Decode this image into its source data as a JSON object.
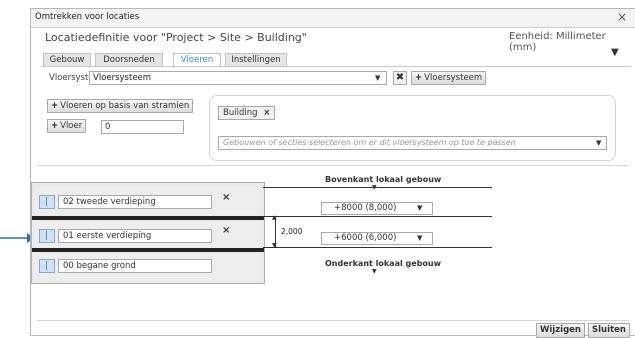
{
  "dialog": {
    "title": "Omtrekken voor locaties",
    "close_glyph": "×",
    "heading": "Locatiedefinitie voor \"Project > Site > Building\"",
    "unit_label": "Eenheid: Millimeter (mm)",
    "menu_glyph": "▼"
  },
  "tabs": [
    {
      "label": "Gebouw",
      "active": false
    },
    {
      "label": "Doorsneden",
      "active": false
    },
    {
      "label": "Vloeren",
      "active": true
    },
    {
      "label": "Instellingen",
      "active": false
    }
  ],
  "vloersysteem": {
    "label": "Vloersysteem",
    "value": "Vloersysteem",
    "remove_glyph": "✖",
    "add_label": "Vloersysteem"
  },
  "left_actions": {
    "stramien_label": "Vloeren op basis van stramien",
    "vloer_label": "Vloer",
    "vloer_count": "0"
  },
  "buildings": {
    "chip_label": "Building",
    "chip_remove": "×",
    "placeholder": "Gebouwen of secties selecteren om er dit vloersysteem op toe te passen"
  },
  "floors": [
    {
      "name": "02 tweede verdieping",
      "removable": true
    },
    {
      "name": "01 eerste verdieping",
      "removable": true
    },
    {
      "name": "00 begane grond",
      "removable": false
    }
  ],
  "levels": {
    "top_label": "Bovenkant lokaal gebouw",
    "bottom_label": "Onderkant lokaal gebouw",
    "upper_value": "+8000 (8,000)",
    "lower_value": "+6000 (6,000)",
    "height_dimension": "2,000"
  },
  "footer": {
    "apply_label": "Wijzigen",
    "close_label": "Sluiten"
  },
  "colors": {
    "active_tab": "#3a8fc8",
    "pointer_arrow": "#2f6ea6"
  },
  "icons": [
    "close-icon",
    "menu-arrow-icon",
    "dropdown-arrow-icon",
    "plus-icon",
    "floor-plan-icon",
    "pointer-arrow-icon"
  ]
}
